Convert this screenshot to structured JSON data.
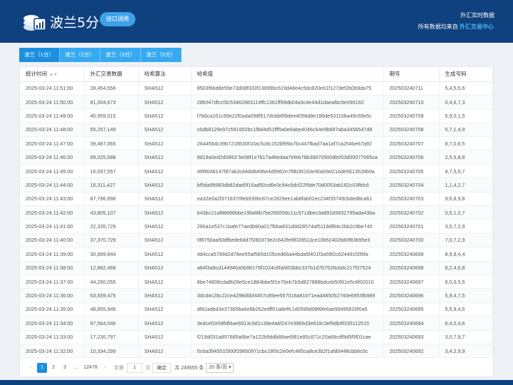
{
  "header": {
    "brand": "波兰5分",
    "api_button": "接口调用",
    "right_title": "外汇实时数据",
    "right_sub_prefix": "所有数据均来自",
    "right_sub_link": "外汇交易中心"
  },
  "tabs": [
    "波兰（1分）",
    "波兰（2分）",
    "波兰（3分）",
    "波兰（5分）"
  ],
  "table": {
    "columns": [
      "统计时间",
      "外汇交易数据",
      "哈希算法",
      "哈希值",
      "期号",
      "生成号码"
    ],
    "rows": [
      [
        "2025-03-24 11:51:00",
        "28,454,556",
        "SHA512",
        "8503f6bd8e59e73d08f333f13699bc619d48e4c5dc820e61f127def2b0b9da75",
        "202503240711",
        "5,4,5,5,6"
      ],
      [
        "2025-03-24 11:50:00",
        "81,004,673",
        "SHA512",
        "28fcf47dfccf3c53462883114ffc1361ff99db04a3c4e44d1daeafbc9e099162",
        "202503240710",
        "0,4,6,7,3"
      ],
      [
        "2025-03-24 11:49:00",
        "40,959,015",
        "SHA512",
        "f7b6ca161c56e22f0ada098f517dcbb6f9dee4058d8e186de531108a49c69e5c",
        "202503240709",
        "5,9,0,1,5"
      ],
      [
        "2025-03-24 11:48:00",
        "55,257,149",
        "SHA512",
        "c6db8129e97c591602bc1fb84d51fff5a0e6abe4046c64e9b687aba345b547d8",
        "202503240708",
        "5,7,1,4,9"
      ],
      [
        "2025-03-24 11:47:00",
        "39,487,065",
        "SHA512",
        "264456dc39b7218530f10ac5c8c152bf99a7bc447fbad7aa1af7ca254be67a92",
        "202503240707",
        "8,7,0,6,5"
      ],
      [
        "2025-03-24 11:46:00",
        "99,025,588",
        "SHA512",
        "8d19a0ed2d0863 5e08f1e7b17a46edaa7efeb78b38870500db053d00077065ca",
        "202503240706",
        "2,5,5,8,8"
      ],
      [
        "2025-03-24 11:45:00",
        "16,097,557",
        "SHA512",
        "49f9048147f87ab3c848d8496e4d9982e7f8b35183e90a59d216de5613528b9a",
        "202503240705",
        "9,7,5,5,7"
      ],
      [
        "2025-03-24 11:44:00",
        "16,311,427",
        "SHA512",
        "bf5da99983db82dad5f16ad50cd6e3c94c6dcf22f9de70d0053ab182c03fbfc6",
        "202503240704",
        "1,1,4,2,7"
      ],
      [
        "2025-03-24 11:43:00",
        "87,796,898",
        "SHA512",
        "ea32e0a2f3716370feb9396c87ce2829ee1ab8fab02ec234f35749cbded8ca61",
        "202503240703",
        "9,6,8,9,8"
      ],
      [
        "2025-03-24 11:42:00",
        "43,805,107",
        "SHA512",
        "643bc21af88666bbe19fa88b7be266558c11c971dbec3a891b5832795ada436a",
        "202503240702",
        "0,5,1,0,7"
      ],
      [
        "2025-03-24 11:41:00",
        "22,335,729",
        "SHA512",
        "290a1e537c1bafe77aedb90a017fbba831ddd28574af5119df84c2bb2c9be740",
        "202503240701",
        "3,5,7,2,9"
      ],
      [
        "2025-03-24 11:40:00",
        "37,370,729",
        "SHA512",
        "0f8750aa50dfbede6dd7f280373e2c642fe6f028513ce10b52402b80f83b95e3",
        "202503240700",
        "7,0,7,2,9"
      ],
      [
        "2025-03-24 11:39:00",
        "30,889,844",
        "SHA512",
        "4d4cca5789d2d78ee55af565d105ced66a44bda5f401f3a59f2c624491f2f6fa",
        "202503240699",
        "8,9,8,4,4"
      ],
      [
        "2025-03-24 11:38:00",
        "12,882,468",
        "SHA512",
        "a84f3a8cd144946a5b96179f1024c6fafd03bbc337b1d7b7528cbdc217f37524",
        "202503240698",
        "8,2,4,6,8"
      ],
      [
        "2025-03-24 11:37:00",
        "44,260,055",
        "SHA512",
        "8be74608cda8b28e5ce1884bbe5f1e76eb7b5d827888bdceb50f61e5c6f02010",
        "202503240697",
        "6,0,0,5,5"
      ],
      [
        "2025-03-24 11:36:00",
        "53,659,475",
        "SHA512",
        "3dcd4c28c22ce4298d5bf4457c85ee557018a81671ead485052740e6953fb989",
        "202503240696",
        "5,9,4,7,5"
      ],
      [
        "2025-03-24 11:35:00",
        "48,855,946",
        "SHA512",
        "df62adbd3e37365ba6e8b262edff01a8effc1d0599d08f6fe6ae99495620f0a5",
        "202503240695",
        "5,5,9,4,6"
      ],
      [
        "2025-03-24 11:34:00",
        "97,564,046",
        "SHA512",
        "3edcef2e58fdf4ae6913c9d1c39e4a6f247e3965d3e818c3ef9db9f335112515",
        "202503240694",
        "6,4,0,4,6"
      ],
      [
        "2025-03-24 11:33:00",
        "17,230,797",
        "SHA512",
        "f219d031a857685a6be7a122b9ddb88ae6f81e85c871c20a69cdf9d5f5f01cae",
        "202503240693",
        "3,0,7,9,7"
      ],
      [
        "2025-03-24 11:32:00",
        "10,334,299",
        "SHA512",
        "0c6a394551f300f29850971cbc18f3c2e0efc485ca8ce3b2f1afd0448cbb6c0c",
        "202503240692",
        "3,4,2,9,9"
      ]
    ]
  },
  "pager": {
    "prev": "‹",
    "pages": [
      "1",
      "2",
      "3"
    ],
    "ellipsis": "...",
    "last": "12478",
    "next": "›",
    "goto_label": "到第",
    "goto_value": "1",
    "page_unit": "页",
    "confirm": "确定",
    "total": "共 249555 条",
    "page_size": "20 条/页"
  },
  "colors": {
    "header_bg": "#10417f",
    "accent": "#1b8fe0",
    "tab_bg": "#35aaf0"
  }
}
